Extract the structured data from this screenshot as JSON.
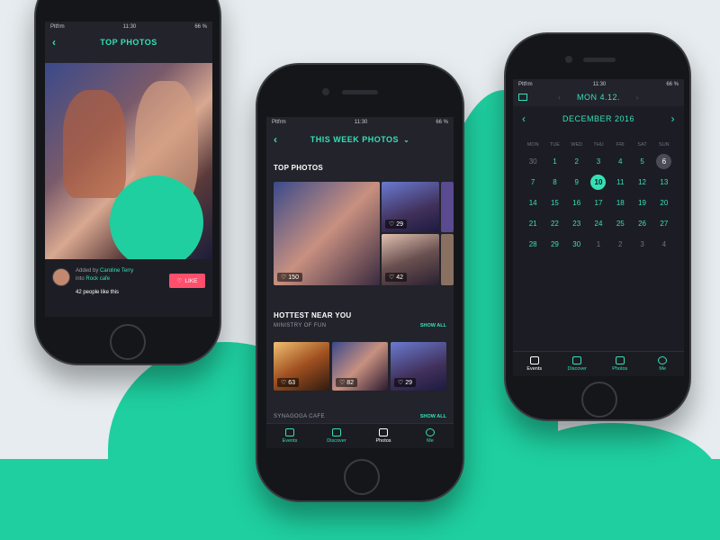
{
  "colors": {
    "accent": "#35e0b6",
    "like": "#ff4f6c",
    "bg": "#22232b"
  },
  "phone1": {
    "status": {
      "carrier": "Pltfrm",
      "time": "11:30",
      "battery": "66 %"
    },
    "title": "TOP PHOTOS",
    "added_by_prefix": "Added by",
    "added_by_name": "Caroline Terry",
    "into_prefix": "into",
    "into_place": "Rock cafe",
    "likes_text": "42 people like this",
    "like_label": "LIKE"
  },
  "phone2": {
    "status": {
      "carrier": "Pltfrm",
      "time": "11:30",
      "battery": "66 %"
    },
    "title": "THIS WEEK PHOTOS",
    "top_photos_heading": "TOP PHOTOS",
    "top_counts": [
      "150",
      "29",
      "42"
    ],
    "hottest_heading": "HOTTEST NEAR YOU",
    "venue1": "MINISTRY OF FUN",
    "show_all": "SHOW ALL",
    "venue1_counts": [
      "63",
      "82",
      "29"
    ],
    "venue2": "SYNAGOGA CAFE",
    "tabs": [
      {
        "label": "Events",
        "icon": "calendar-icon"
      },
      {
        "label": "Discover",
        "icon": "map-icon"
      },
      {
        "label": "Photos",
        "icon": "photos-icon"
      },
      {
        "label": "Me",
        "icon": "profile-icon"
      }
    ]
  },
  "phone3": {
    "status": {
      "carrier": "Pltfrm",
      "time": "11:30",
      "battery": "66 %"
    },
    "date_title": "MON 4.12.",
    "month_title": "DECEMBER 2016",
    "weekdays": [
      "MON",
      "TUE",
      "WED",
      "THU",
      "FRI",
      "SAT",
      "SUN"
    ],
    "days": [
      "30",
      "1",
      "2",
      "3",
      "4",
      "5",
      "6",
      "7",
      "8",
      "9",
      "10",
      "11",
      "12",
      "13",
      "14",
      "15",
      "16",
      "17",
      "18",
      "19",
      "20",
      "21",
      "22",
      "23",
      "24",
      "25",
      "26",
      "27",
      "28",
      "29",
      "30",
      "1",
      "2",
      "3",
      "4"
    ],
    "selected_day": "10",
    "tabs": [
      {
        "label": "Events",
        "icon": "calendar-icon"
      },
      {
        "label": "Discover",
        "icon": "map-icon"
      },
      {
        "label": "Photos",
        "icon": "photos-icon"
      },
      {
        "label": "Me",
        "icon": "profile-icon"
      }
    ]
  }
}
